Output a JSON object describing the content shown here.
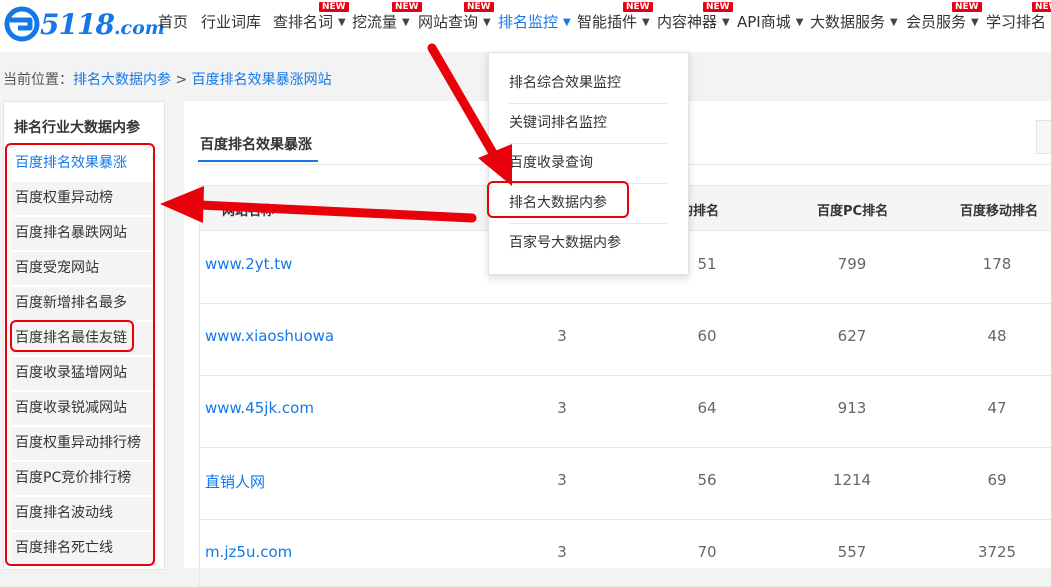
{
  "logo": {
    "brand": "5118",
    "suffix": ".com",
    "color": "#1478e8"
  },
  "nav": {
    "items": [
      {
        "label": "首页",
        "has_caret": false,
        "new": false,
        "active": false
      },
      {
        "label": "行业词库",
        "has_caret": false,
        "new": false,
        "active": false
      },
      {
        "label": "查排名词",
        "has_caret": true,
        "new": true,
        "active": false
      },
      {
        "label": "挖流量",
        "has_caret": true,
        "new": true,
        "active": false
      },
      {
        "label": "网站查询",
        "has_caret": true,
        "new": true,
        "active": false
      },
      {
        "label": "排名监控",
        "has_caret": true,
        "new": false,
        "active": true
      },
      {
        "label": "智能插件",
        "has_caret": true,
        "new": true,
        "active": false
      },
      {
        "label": "内容神器",
        "has_caret": true,
        "new": true,
        "active": false
      },
      {
        "label": "API商城",
        "has_caret": true,
        "new": false,
        "active": false
      },
      {
        "label": "大数据服务",
        "has_caret": true,
        "new": false,
        "active": false
      },
      {
        "label": "会员服务",
        "has_caret": true,
        "new": true,
        "active": false
      },
      {
        "label": "学习排名",
        "has_caret": false,
        "new": true,
        "active": false
      }
    ],
    "new_badge": "NEW",
    "badge_color": "#e60012",
    "active_color": "#1478e8"
  },
  "breadcrumb": {
    "prefix": "当前位置：",
    "parent": "排名大数据内参",
    "separator": ">",
    "current": "百度排名效果暴涨网站"
  },
  "sidebar": {
    "title": "排名行业大数据内参",
    "items": [
      {
        "label": "百度排名效果暴涨",
        "active": true
      },
      {
        "label": "百度权重异动榜",
        "active": false
      },
      {
        "label": "百度排名暴跌网站",
        "active": false
      },
      {
        "label": "百度受宠网站",
        "active": false
      },
      {
        "label": "百度新增排名最多",
        "active": false
      },
      {
        "label": "百度排名最佳友链",
        "active": false
      },
      {
        "label": "百度收录猛增网站",
        "active": false
      },
      {
        "label": "百度收录锐减网站",
        "active": false
      },
      {
        "label": "百度权重异动排行榜",
        "active": false
      },
      {
        "label": "百度PC竞价排行榜",
        "active": false
      },
      {
        "label": "百度排名波动线",
        "active": false
      },
      {
        "label": "百度排名死亡线",
        "active": false
      }
    ]
  },
  "main": {
    "tab_title": "百度排名效果暴涨",
    "columns": [
      "网站名称",
      "平均排名",
      "百度PC排名",
      "百度移动排名"
    ],
    "rows": [
      {
        "site": "www.2yt.tw",
        "col2": "",
        "avg": "51",
        "pc": "799",
        "mobile": "178"
      },
      {
        "site": "www.xiaoshuowa",
        "col2": "3",
        "avg": "60",
        "pc": "627",
        "mobile": "48"
      },
      {
        "site": "www.45jk.com",
        "col2": "3",
        "avg": "64",
        "pc": "913",
        "mobile": "47"
      },
      {
        "site": "直销人网",
        "col2": "3",
        "avg": "56",
        "pc": "1214",
        "mobile": "69"
      },
      {
        "site": "m.jz5u.com",
        "col2": "3",
        "avg": "70",
        "pc": "557",
        "mobile": "3725"
      }
    ]
  },
  "dropdown": {
    "items": [
      "排名综合效果监控",
      "关键词排名监控",
      "百度收录查询",
      "排名大数据内参",
      "百家号大数据内参"
    ]
  },
  "annotation_color": "#e8000b"
}
